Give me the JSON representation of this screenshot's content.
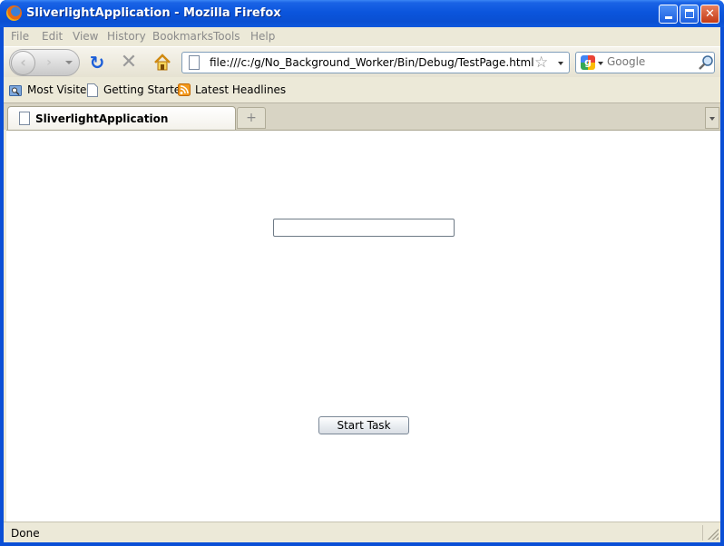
{
  "window": {
    "title": "SliverlightApplication - Mozilla Firefox",
    "controls": {
      "minimize": "minimize",
      "maximize": "maximize",
      "close": "✕"
    }
  },
  "menu": [
    "File",
    "Edit",
    "View",
    "History",
    "Bookmarks",
    "Tools",
    "Help"
  ],
  "navigation": {
    "address": "file:///c:/g/No_Background_Worker/Bin/Debug/TestPage.html",
    "search_placeholder": "Google",
    "search_engine": "Google"
  },
  "bookmarks": [
    "Most Visited",
    "Getting Started",
    "Latest Headlines"
  ],
  "tabs": [
    {
      "label": "SliverlightApplication",
      "active": true
    }
  ],
  "page": {
    "textbox_value": "",
    "button_label": "Start Task"
  },
  "status": {
    "text": "Done"
  },
  "colors": {
    "titlebar": "#0b55dc",
    "chrome": "#ece9d8",
    "accent": "#1b5ed8"
  }
}
